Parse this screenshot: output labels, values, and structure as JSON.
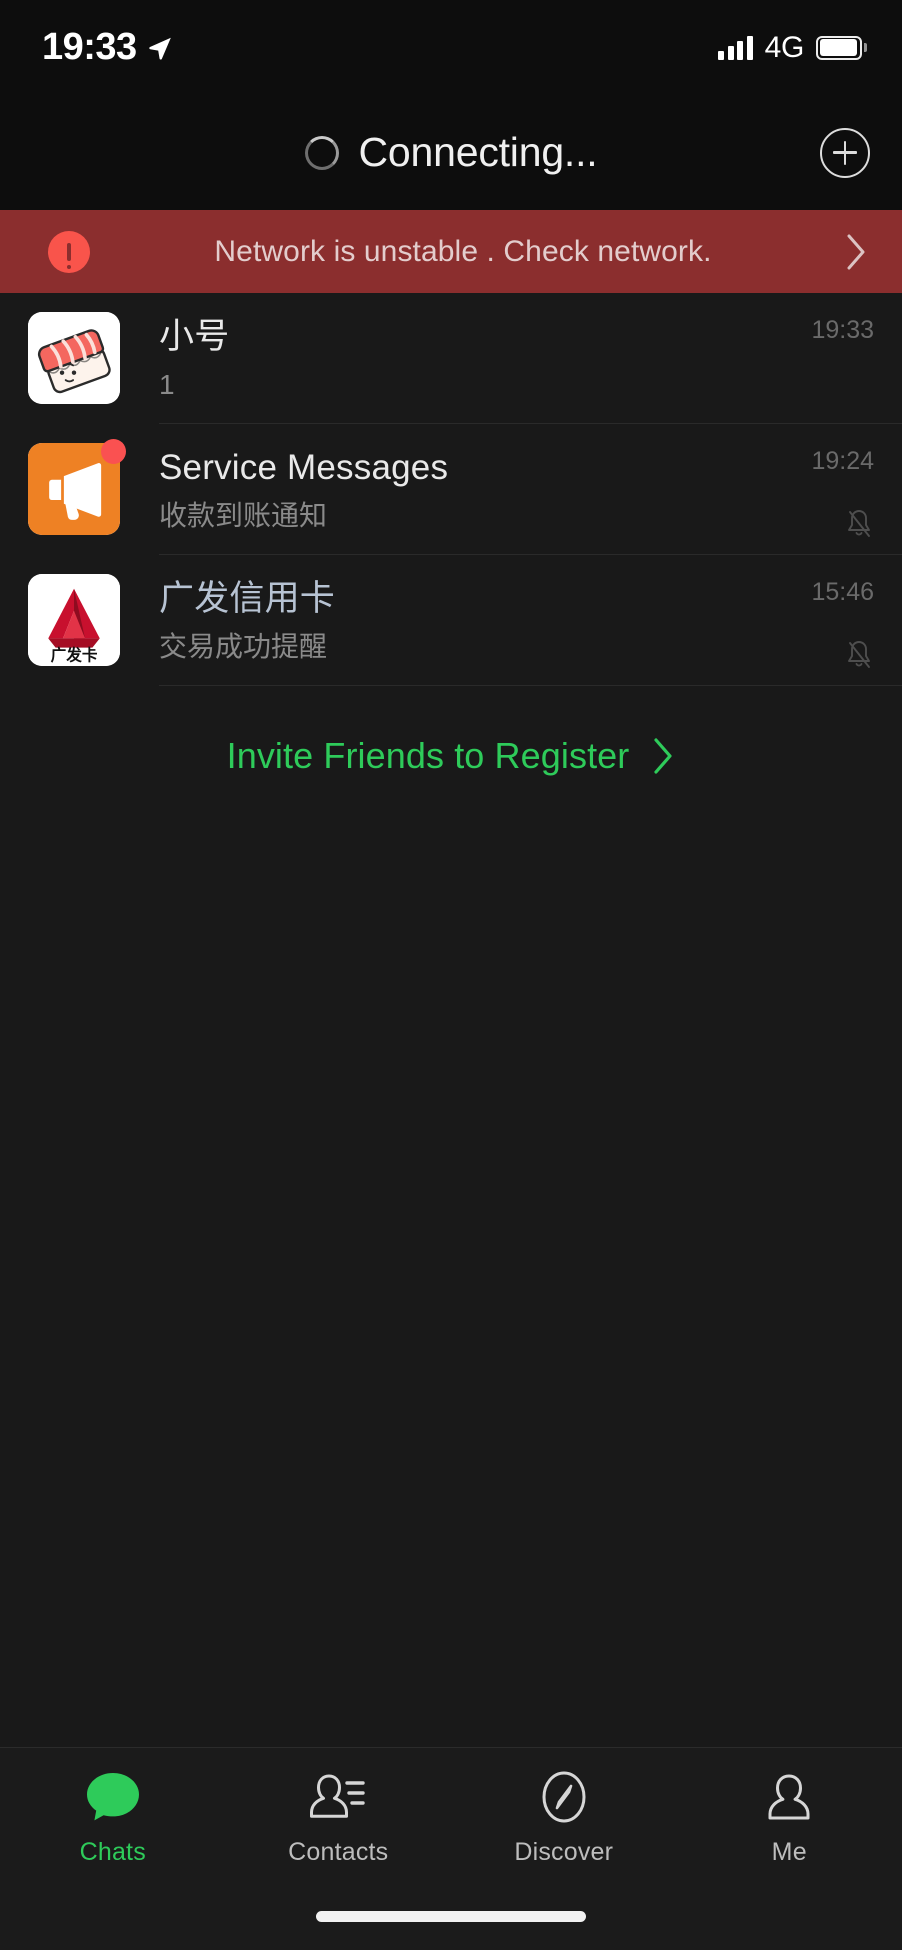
{
  "status_bar": {
    "time": "19:33",
    "location_icon": "location-arrow-icon",
    "signal_icon": "signal-bars-icon",
    "network": "4G",
    "battery_icon": "battery-icon"
  },
  "navbar": {
    "title": "Connecting...",
    "spinner_icon": "loading-spinner-icon",
    "add_icon": "plus-circle-icon"
  },
  "network_banner": {
    "alert_icon": "exclamation-circle-icon",
    "message": "Network is unstable . Check network.",
    "chevron_icon": "chevron-right-icon",
    "background_color": "#8b2e2e",
    "icon_color": "#f9544b"
  },
  "chats": [
    {
      "avatar_icon": "sushi-avatar",
      "title": "小号",
      "preview": "1",
      "time": "19:33",
      "muted": false,
      "badge": false,
      "title_style": "default"
    },
    {
      "avatar_icon": "megaphone-avatar",
      "title": "Service Messages",
      "preview": "收款到账通知",
      "time": "19:24",
      "muted": true,
      "badge": true,
      "title_style": "default"
    },
    {
      "avatar_icon": "cgb-card-avatar",
      "title": "广发信用卡",
      "preview": "交易成功提醒",
      "time": "15:46",
      "muted": true,
      "badge": false,
      "title_style": "blue"
    }
  ],
  "invite": {
    "label": "Invite Friends to Register",
    "chevron_icon": "chevron-right-icon",
    "color": "#2ecb5a"
  },
  "tabbar": {
    "active_index": 0,
    "accent_color": "#2ecb5a",
    "items": [
      {
        "label": "Chats",
        "icon": "chat-bubble-icon"
      },
      {
        "label": "Contacts",
        "icon": "contacts-icon"
      },
      {
        "label": "Discover",
        "icon": "compass-icon"
      },
      {
        "label": "Me",
        "icon": "person-icon"
      }
    ]
  }
}
